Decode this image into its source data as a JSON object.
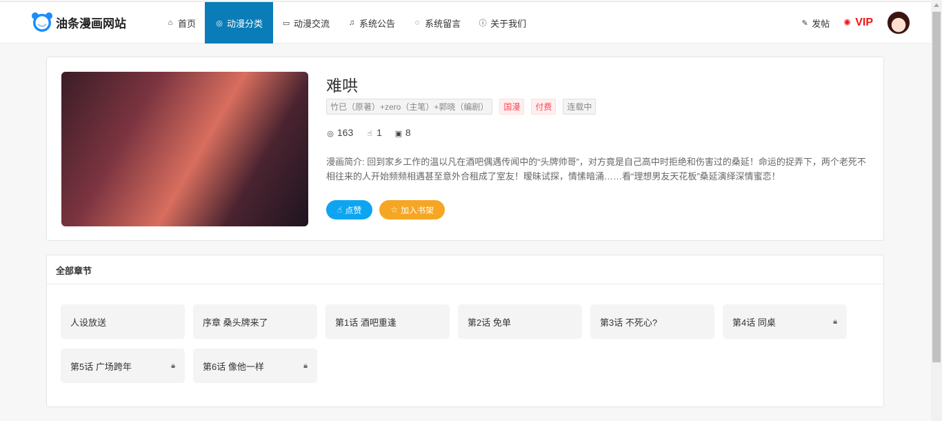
{
  "site": {
    "name": "油条漫画网站"
  },
  "nav": [
    {
      "label": "首页",
      "icon": "home-icon"
    },
    {
      "label": "动漫分类",
      "icon": "compass-icon",
      "active": true
    },
    {
      "label": "动漫交流",
      "icon": "chat-icon"
    },
    {
      "label": "系统公告",
      "icon": "bell-icon"
    },
    {
      "label": "系统留言",
      "icon": "message-icon"
    },
    {
      "label": "关于我们",
      "icon": "info-icon"
    }
  ],
  "header": {
    "post": "发帖",
    "vip": "VIP",
    "vip_color": "#f01414"
  },
  "comic": {
    "title": "难哄",
    "authors": "竹已（原著）+zero（主笔）+郭晓（编剧）",
    "tags": [
      "国漫",
      "付费",
      "连载中"
    ],
    "views": "163",
    "likes": "1",
    "chapters_count": "8",
    "desc": "漫画简介: 回到家乡工作的温以凡在酒吧偶遇传闻中的“头牌帅哥”，对方竟是自己高中时拒绝和伤害过的桑延！命运的捉弄下，两个老死不相往来的人开始频频相遇甚至意外合租成了室友！暧昧试探，情愫暗涌……看“理想男友天花板”桑延演绎深情蜜恋！",
    "like_btn": "点赞",
    "shelf_btn": "加入书架"
  },
  "chapters": {
    "heading": "全部章节",
    "items": [
      {
        "t": "人设放送",
        "locked": false
      },
      {
        "t": "序章 桑头牌来了",
        "locked": false
      },
      {
        "t": "第1话 酒吧重逢",
        "locked": false
      },
      {
        "t": "第2话 免单",
        "locked": false
      },
      {
        "t": "第3话 不死心?",
        "locked": false
      },
      {
        "t": "第4话 同桌",
        "locked": true
      },
      {
        "t": "第5话 广场跨年",
        "locked": true
      },
      {
        "t": "第6话 像他一样",
        "locked": true
      }
    ]
  }
}
